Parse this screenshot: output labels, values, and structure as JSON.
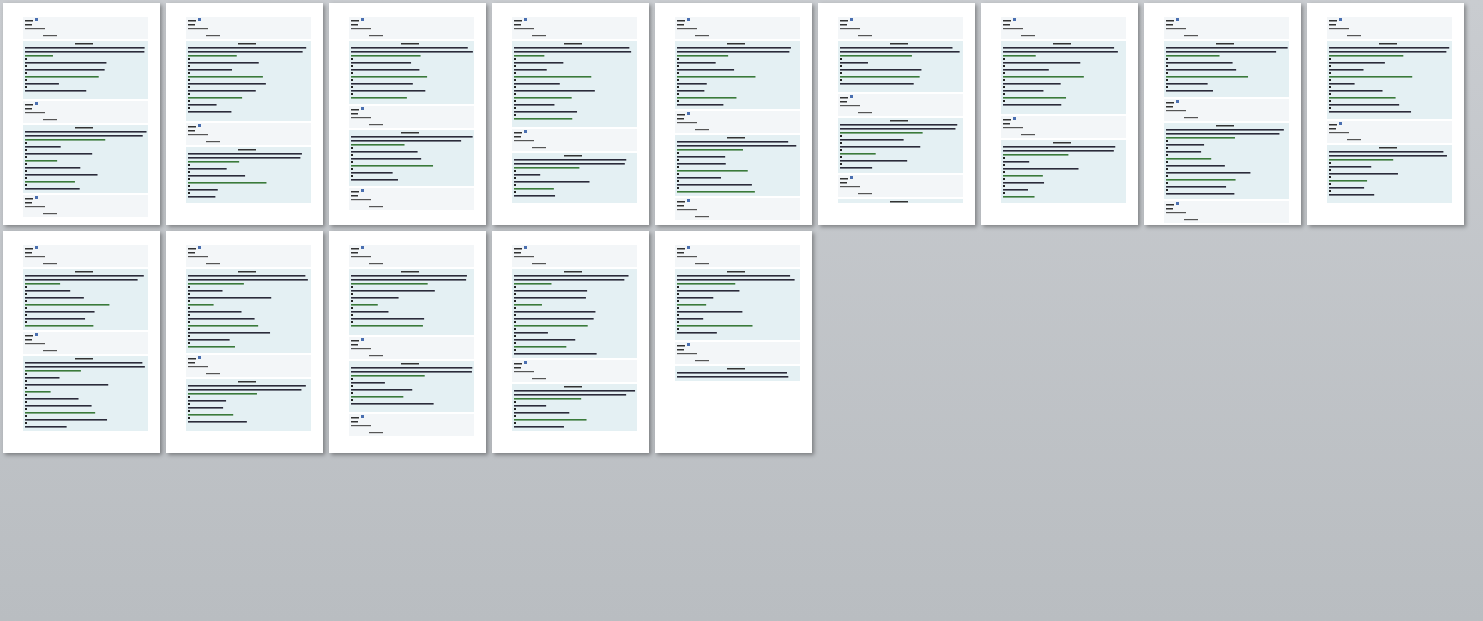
{
  "pages": [
    {
      "kind": "page"
    },
    {
      "kind": "page"
    },
    {
      "kind": "page"
    },
    {
      "kind": "page"
    },
    {
      "kind": "page"
    },
    {
      "kind": "page"
    },
    {
      "kind": "page"
    },
    {
      "kind": "page"
    },
    {
      "kind": "page"
    },
    {
      "kind": "page"
    },
    {
      "kind": "page"
    },
    {
      "kind": "page"
    },
    {
      "kind": "page"
    },
    {
      "kind": "page"
    }
  ]
}
